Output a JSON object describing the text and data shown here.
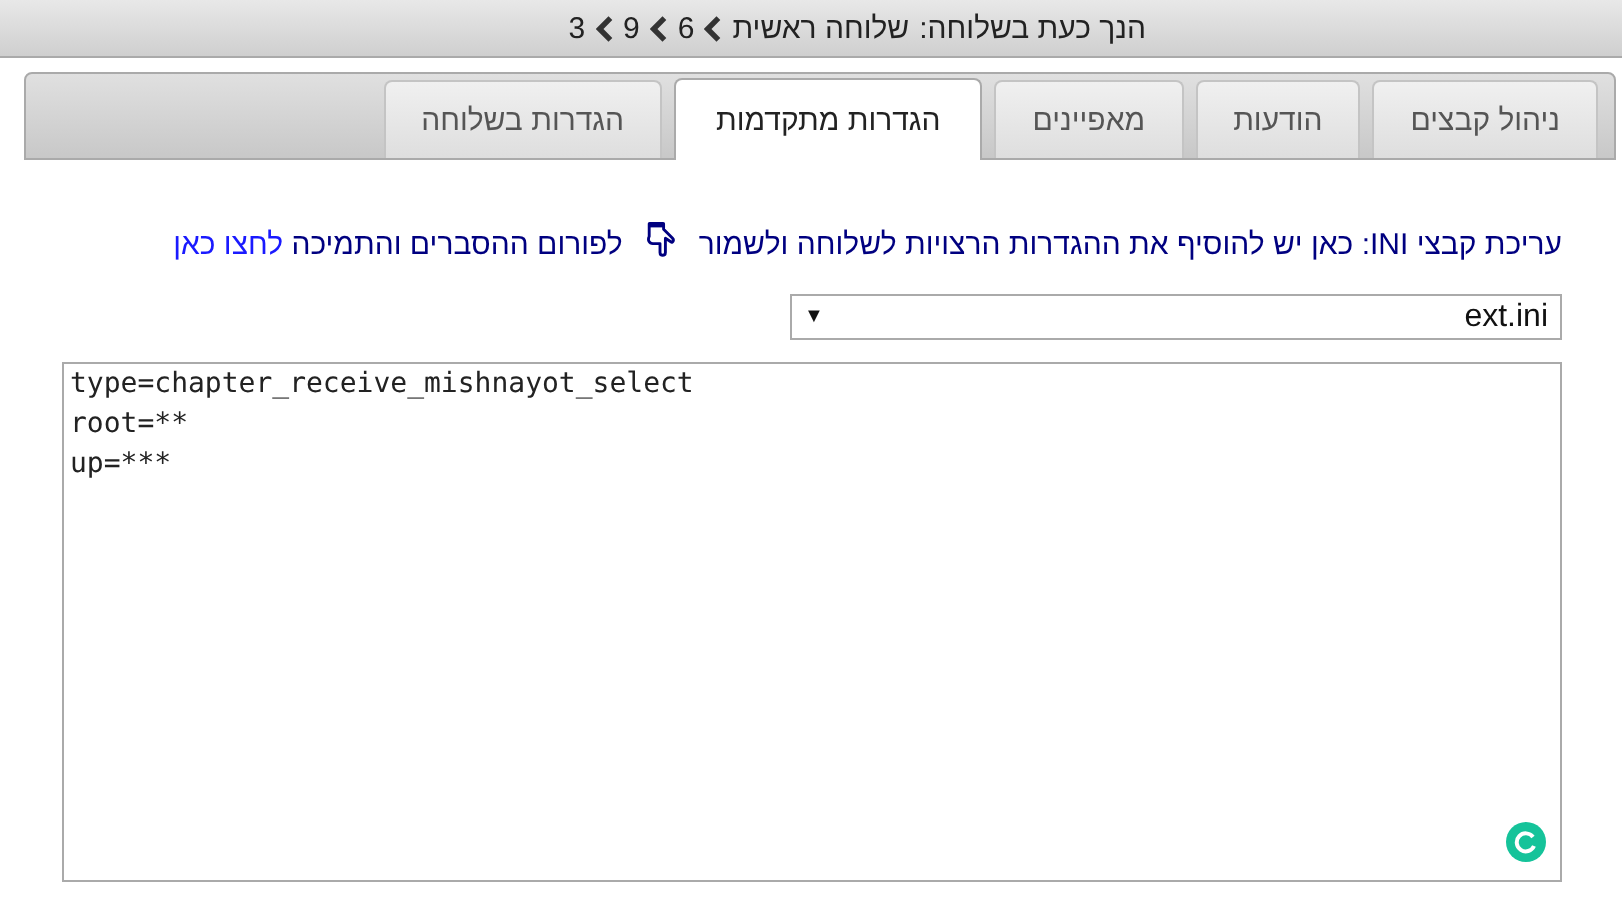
{
  "breadcrumb": {
    "label": "הנך כעת בשלוחה:",
    "items": [
      "שלוחה ראשית",
      "6",
      "9",
      "3"
    ]
  },
  "tabs": [
    {
      "label": "ניהול קבצים",
      "selected": false
    },
    {
      "label": "הודעות",
      "selected": false
    },
    {
      "label": "מאפיינים",
      "selected": false
    },
    {
      "label": "הגדרות מתקדמות",
      "selected": true
    },
    {
      "label": "הגדרות בשלוחה",
      "selected": false
    }
  ],
  "intro": {
    "text": "עריכת קבצי INI: כאן יש להוסיף את ההגדרות הרצויות לשלוחה ולשמור",
    "forum": "לפורום ההסברים והתמיכה",
    "link": "לחצו כאן"
  },
  "file_select": {
    "value": "ext.ini",
    "arrow": "▼"
  },
  "editor": {
    "lines": [
      "type=chapter_receive_mishnayot_select",
      "root=**",
      "up=***"
    ]
  }
}
